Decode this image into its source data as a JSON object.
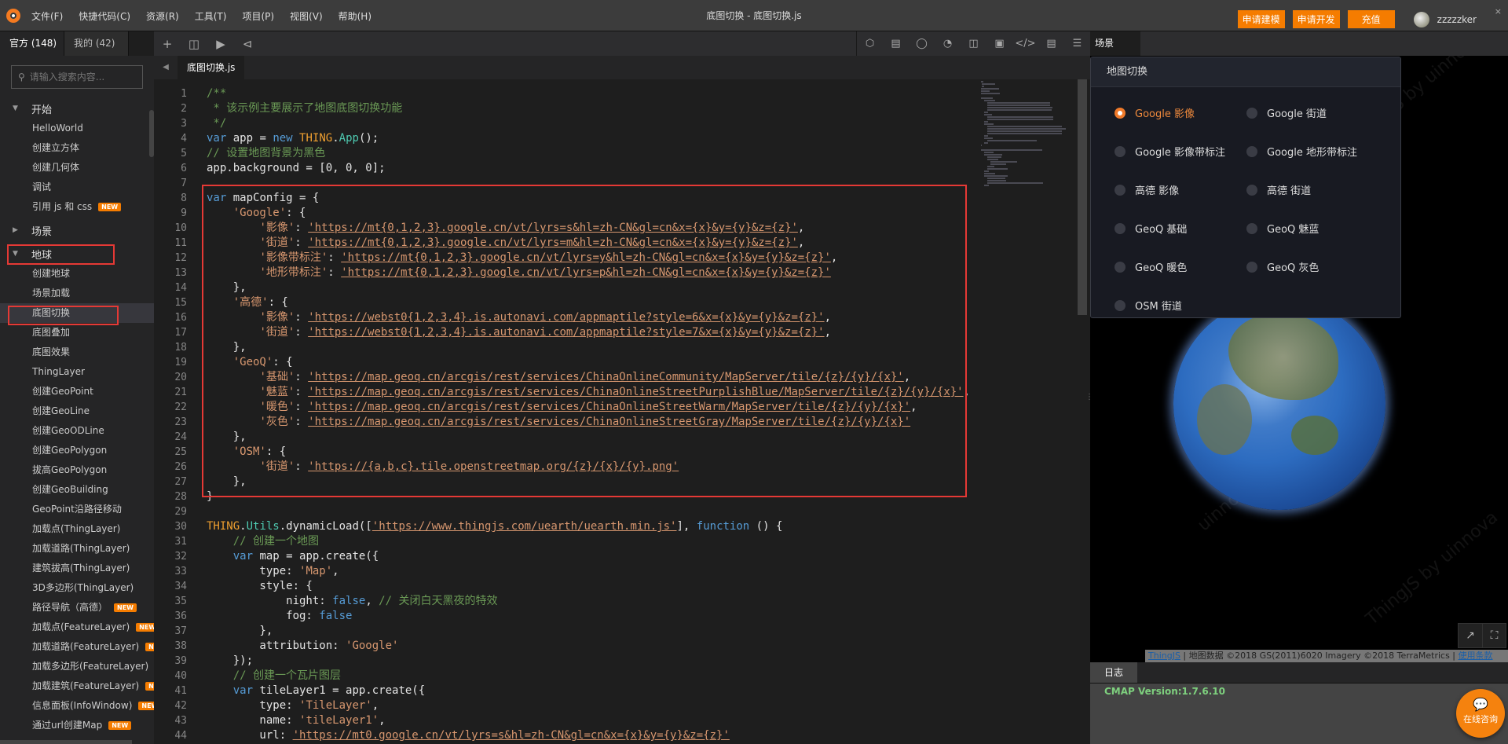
{
  "titlebar": {
    "menu": [
      "文件(F)",
      "快捷代码(C)",
      "资源(R)",
      "工具(T)",
      "项目(P)",
      "视图(V)",
      "帮助(H)"
    ],
    "title": "底图切换 - 底图切换.js",
    "buttons": [
      "申请建模",
      "申请开发",
      "充值"
    ],
    "username": "zzzzzker",
    "close": "×"
  },
  "sidebar": {
    "tabs": [
      "官方 (148)",
      "我的 (42)"
    ],
    "search_placeholder": "请输入搜索内容...",
    "badge": "NEW",
    "groups": [
      {
        "label": "开始",
        "expanded": true,
        "items": [
          {
            "label": "HelloWorld"
          },
          {
            "label": "创建立方体"
          },
          {
            "label": "创建几何体"
          },
          {
            "label": "调试"
          },
          {
            "label": "引用 js 和 css",
            "new": true
          }
        ]
      },
      {
        "label": "场景",
        "expanded": false,
        "items": []
      },
      {
        "label": "地球",
        "expanded": true,
        "items": [
          {
            "label": "创建地球"
          },
          {
            "label": "场景加载"
          },
          {
            "label": "底图切换",
            "selected": true
          },
          {
            "label": "底图叠加"
          },
          {
            "label": "底图效果"
          },
          {
            "label": "ThingLayer"
          },
          {
            "label": "创建GeoPoint"
          },
          {
            "label": "创建GeoLine"
          },
          {
            "label": "创建GeoODLine"
          },
          {
            "label": "创建GeoPolygon"
          },
          {
            "label": "拔高GeoPolygon"
          },
          {
            "label": "创建GeoBuilding"
          },
          {
            "label": "GeoPoint沿路径移动"
          },
          {
            "label": "加载点(ThingLayer)"
          },
          {
            "label": "加载道路(ThingLayer)"
          },
          {
            "label": "建筑拔高(ThingLayer)"
          },
          {
            "label": "3D多边形(ThingLayer)"
          },
          {
            "label": "路径导航（高德）",
            "new": true
          },
          {
            "label": "加载点(FeatureLayer)",
            "new": true
          },
          {
            "label": "加载道路(FeatureLayer)",
            "new": true
          },
          {
            "label": "加载多边形(FeatureLayer)",
            "new": true
          },
          {
            "label": "加载建筑(FeatureLayer)",
            "new": true
          },
          {
            "label": "信息面板(InfoWindow)",
            "new": true
          },
          {
            "label": "通过url创建Map",
            "new": true
          }
        ]
      }
    ]
  },
  "toolbar": {
    "left_icons": [
      "plus-icon",
      "save-icon",
      "run-icon",
      "share-icon"
    ],
    "right_icons": [
      "cube-icon",
      "building-icon",
      "globe-icon",
      "pie-chart-icon",
      "layout-icon",
      "image-icon",
      "code-icon",
      "document-icon",
      "settings-sliders-icon"
    ]
  },
  "editor": {
    "tab": "底图切换.js",
    "lines": [
      "/**",
      " * 该示例主要展示了地图底图切换功能",
      " */",
      "var app = new THING.App();",
      "// 设置地图背景为黑色",
      "app.background = [0, 0, 0];",
      "",
      "var mapConfig = {",
      "    'Google': {",
      "        '影像': 'https://mt{0,1,2,3}.google.cn/vt/lyrs=s&hl=zh-CN&gl=cn&x={x}&y={y}&z={z}',",
      "        '街道': 'https://mt{0,1,2,3}.google.cn/vt/lyrs=m&hl=zh-CN&gl=cn&x={x}&y={y}&z={z}',",
      "        '影像带标注': 'https://mt{0,1,2,3}.google.cn/vt/lyrs=y&hl=zh-CN&gl=cn&x={x}&y={y}&z={z}',",
      "        '地形带标注': 'https://mt{0,1,2,3}.google.cn/vt/lyrs=p&hl=zh-CN&gl=cn&x={x}&y={y}&z={z}'",
      "    },",
      "    '高德': {",
      "        '影像': 'https://webst0{1,2,3,4}.is.autonavi.com/appmaptile?style=6&x={x}&y={y}&z={z}',",
      "        '街道': 'https://webst0{1,2,3,4}.is.autonavi.com/appmaptile?style=7&x={x}&y={y}&z={z}',",
      "    },",
      "    'GeoQ': {",
      "        '基础': 'https://map.geoq.cn/arcgis/rest/services/ChinaOnlineCommunity/MapServer/tile/{z}/{y}/{x}',",
      "        '魅蓝': 'https://map.geoq.cn/arcgis/rest/services/ChinaOnlineStreetPurplishBlue/MapServer/tile/{z}/{y}/{x}',",
      "        '暖色': 'https://map.geoq.cn/arcgis/rest/services/ChinaOnlineStreetWarm/MapServer/tile/{z}/{y}/{x}',",
      "        '灰色': 'https://map.geoq.cn/arcgis/rest/services/ChinaOnlineStreetGray/MapServer/tile/{z}/{y}/{x}'",
      "    },",
      "    'OSM': {",
      "        '街道': 'https://{a,b,c}.tile.openstreetmap.org/{z}/{x}/{y}.png'",
      "    },",
      "}",
      "",
      "THING.Utils.dynamicLoad(['https://www.thingjs.com/uearth/uearth.min.js'], function () {",
      "    // 创建一个地图",
      "    var map = app.create({",
      "        type: 'Map',",
      "        style: {",
      "            night: false, // 关闭白天黑夜的特效",
      "            fog: false",
      "        },",
      "        attribution: 'Google'",
      "    });",
      "    // 创建一个瓦片图层",
      "    var tileLayer1 = app.create({",
      "        type: 'TileLayer',",
      "        name: 'tileLayer1',",
      "        url: 'https://mt0.google.cn/vt/lyrs=s&hl=zh-CN&gl=cn&x={x}&y={y}&z={z}'",
      "    });"
    ]
  },
  "scene": {
    "tab": "场景",
    "panel_title": "地图切换",
    "options": [
      {
        "label": "Google 影像",
        "selected": true
      },
      {
        "label": "Google 街道"
      },
      {
        "label": "Google 影像带标注"
      },
      {
        "label": "Google 地形带标注"
      },
      {
        "label": "高德 影像"
      },
      {
        "label": "高德 街道"
      },
      {
        "label": "GeoQ 基础"
      },
      {
        "label": "GeoQ 魅蓝"
      },
      {
        "label": "GeoQ 暖色"
      },
      {
        "label": "GeoQ 灰色"
      },
      {
        "label": "OSM 街道"
      }
    ],
    "watermark": "ThingJS by uinnova",
    "watermark2": "uinnova",
    "attribution": {
      "link": "ThingJS",
      "text": " | 地图数据 ©2018 GS(2011)6020 Imagery ©2018 TerraMetrics | ",
      "terms": "使用条款"
    }
  },
  "log": {
    "tab": "日志",
    "lines": [
      "CMAP Version:1.7.6.10"
    ]
  },
  "chat": {
    "label": "在线咨询"
  },
  "colors": {
    "accent": "#f57c00",
    "highlight_box": "#e53935",
    "log_text": "#7ed07e"
  }
}
